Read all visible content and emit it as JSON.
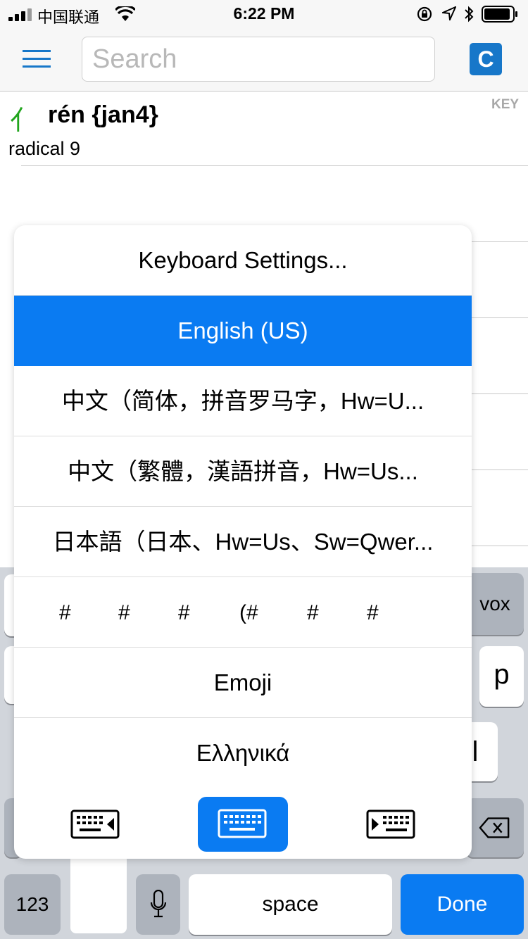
{
  "status_bar": {
    "carrier": "中国联通",
    "time": "6:22 PM"
  },
  "nav": {
    "search_placeholder": "Search",
    "c_button_label": "C"
  },
  "entry": {
    "glyph": "亻",
    "title": "rén {jan4}",
    "subtitle": "radical 9",
    "key_label": "KEY"
  },
  "popup": {
    "settings_label": "Keyboard Settings...",
    "items": [
      "English (US)",
      "中文（简体，拼音罗马字，Hw=U...",
      "中文（繁體，漢語拼音，Hw=Us...",
      "日本語（日本、Hw=Us、Sw=Qwer...",
      "Emoji",
      "Ελληνικά"
    ],
    "hash_row": [
      "#",
      "#",
      "#",
      "(#",
      "#",
      "#"
    ],
    "selected_item": "English (US)"
  },
  "keyboard": {
    "visible_key_vox": "vox",
    "visible_key_p": "p",
    "visible_key_l": "l",
    "key_123": "123",
    "space_label": "space",
    "done_label": "Done"
  },
  "colors": {
    "accent": "#0a7bf2",
    "brand": "#1777c9",
    "radical": "#21a51d"
  }
}
